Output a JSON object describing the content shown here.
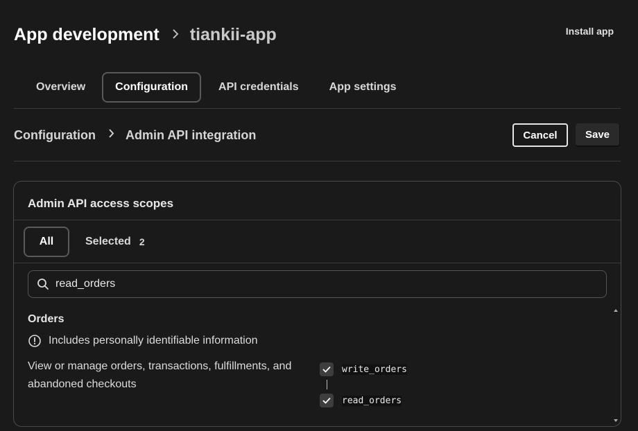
{
  "header": {
    "title": "App development",
    "app_name": "tiankii-app",
    "install_label": "Install app"
  },
  "tabs": [
    {
      "label": "Overview"
    },
    {
      "label": "Configuration"
    },
    {
      "label": "API credentials"
    },
    {
      "label": "App settings"
    }
  ],
  "breadcrumb": {
    "parent": "Configuration",
    "current": "Admin API integration"
  },
  "actions": {
    "cancel_label": "Cancel",
    "save_label": "Save"
  },
  "scopes_card": {
    "title": "Admin API access scopes",
    "tabs": {
      "all_label": "All",
      "selected_label": "Selected",
      "selected_count": "2"
    },
    "search": {
      "value": "read_orders"
    },
    "section": {
      "title": "Orders",
      "pii_note": "Includes personally identifiable information",
      "description": "View or manage orders, transactions, fulfillments, and abandoned checkouts",
      "scopes": [
        {
          "name": "write_orders",
          "checked": true
        },
        {
          "name": "read_orders",
          "checked": true
        }
      ]
    }
  },
  "icons": {
    "breadcrumb_separator": "chevron-right-icon",
    "search": "search-icon",
    "pii": "info-circle-icon",
    "checkbox": "checkmark-icon"
  },
  "colors": {
    "background": "#1a1a1a",
    "text": "#e3e3e3",
    "border": "#3b3b3b"
  }
}
